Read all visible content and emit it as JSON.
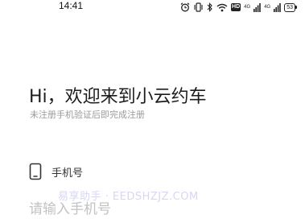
{
  "status_bar": {
    "time": "14:41",
    "hd_badge": "HD",
    "network_1": "4G",
    "network_2": "4G",
    "battery_level": "53"
  },
  "login": {
    "greeting": "Hi，欢迎来到小云约车",
    "subtitle": "未注册手机验证后即完成注册",
    "phone_label": "手机号",
    "phone_placeholder": "请输入手机号",
    "phone_value": ""
  },
  "watermark": "易享助手 · EEDSHZJZ.COM"
}
